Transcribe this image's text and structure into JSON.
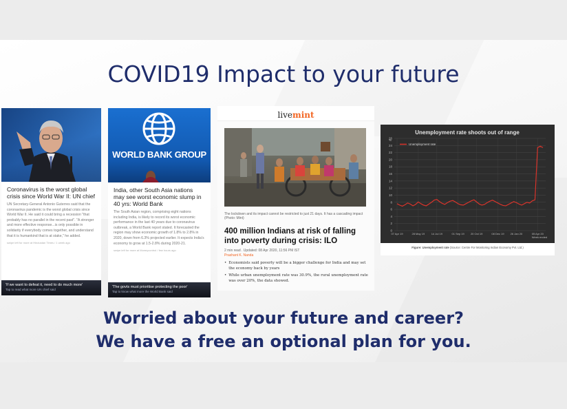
{
  "slide": {
    "title": "COVID19 Impact to your future",
    "subtitle_line1": "Worried about your future and career?",
    "subtitle_line2": "We have a free an optional plan for you."
  },
  "card_un": {
    "headline": "Coronavirus is the worst global crisis since World War II: UN chief",
    "body": "UN Secretary-General Antonio Guterres said that the coronavirus pandemic is the worst global crisis since World War II. He said it could bring a recession \"that probably has no parallel in the recent past\". \"A stronger and more effective response...is only possible in solidarity if everybody comes together, and understand that it is humankind that is at stake,\" he added.",
    "source": "swipe left for more at Hindustan Times / 1 week ago",
    "footer_line1": "'If we want to defeat it, need to do much more'",
    "footer_line2": "Tap to read what more UN chief said"
  },
  "card_wb": {
    "logo_text": "WORLD BANK GROUP",
    "headline": "India, other South Asia nations may see worst economic slump in 40 yrs: World Bank",
    "body": "The South Asian region, comprising eight nations including India, is likely to record its worst economic performance in the last 40 years due to coronavirus outbreak, a World Bank report stated. It forecasted the region may show economic growth of 1.8% to 2.8% in 2020, down from 6.3% projected earlier. It expects India's economy to grow at 1.5-2.8% during 2020-21.",
    "source": "swipe left for more at Moneycontrol / few hours ago",
    "footer_line1": "'The govts must prioritise protecting the poor'",
    "footer_line2": "Tap to know what more the World Bank said"
  },
  "card_mint": {
    "brand_live": "live",
    "brand_mint": "mint",
    "caption": "The lockdown and its impact cannot be restricted to just 21 days. It has a cascading impact (Photo: Mint)",
    "headline": "400 million Indians at risk of falling into poverty during crisis: ILO",
    "meta": "2 min read . Updated: 08 Apr 2020, 11:56 PM IST",
    "author": "Prashant K. Nanda",
    "bullet1": "Economists said poverty will be a bigger challenge for India and may set the economy back by years",
    "bullet2": "While urban unemployment rate was 30.9%, the rural unemployment rate was over 20%, the data showed."
  },
  "chart_data": {
    "type": "line",
    "title": "Unemployment rate shoots out of range",
    "ylabel": "%",
    "series_name": "Unemployment rate",
    "ylim": [
      0,
      26
    ],
    "yticks": [
      0,
      2,
      4,
      6,
      8,
      10,
      12,
      14,
      16,
      18,
      20,
      22,
      24,
      26
    ],
    "xtick_labels": [
      "07 Apr 19",
      "28 May 19",
      "14 Jul 19",
      "01 Sep 19",
      "20 Oct 19",
      "08 Dec 19",
      "26 Jan 20",
      "05 Apr 20"
    ],
    "xlabel": "Week ended",
    "values": [
      7.6,
      7.2,
      6.9,
      7.3,
      7.8,
      7.5,
      7.0,
      7.4,
      8.1,
      7.6,
      7.2,
      7.0,
      7.5,
      8.0,
      8.6,
      8.8,
      8.2,
      7.7,
      7.4,
      7.9,
      8.3,
      8.5,
      8.1,
      7.6,
      7.3,
      7.2,
      7.6,
      8.0,
      8.4,
      8.7,
      8.1,
      7.5,
      7.2,
      7.4,
      7.9,
      8.3,
      8.6,
      8.2,
      7.8,
      7.4,
      7.1,
      7.0,
      7.4,
      7.8,
      8.2,
      7.9,
      7.5,
      7.2,
      7.6,
      8.0,
      7.8,
      8.4,
      8.7,
      23.4,
      23.8,
      23.4
    ],
    "background": "#2d2d2d",
    "line_color": "#d9342b",
    "grid": true,
    "legend": "top-left",
    "caption_label": "Figure: Unemployment rate",
    "caption_source": "(Source: Centre For Monitoring Indian Economy Pvt. Ltd.)"
  }
}
